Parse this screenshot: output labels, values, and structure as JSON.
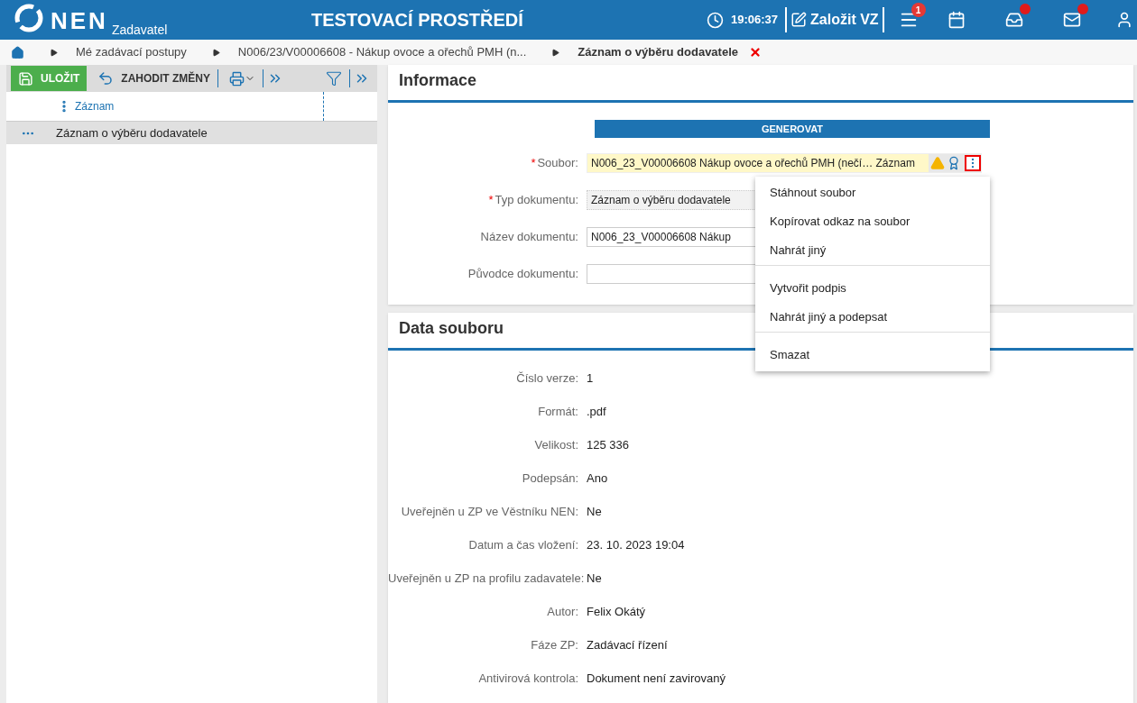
{
  "header": {
    "logo": "NEN",
    "subtitle": "Zadavatel",
    "environment": "TESTOVACÍ PROSTŘEDÍ",
    "time": "19:06:37",
    "create_button": "Založit VZ",
    "menu_badge": "1",
    "inbox_dot": true,
    "mail_dot": true
  },
  "breadcrumb": {
    "items": [
      "Mé zadávací postupy",
      "N006/23/V00006608 - Nákup ovoce a ořechů PMH (n...",
      "Záznam o výběru dodavatele"
    ]
  },
  "toolbar": {
    "save": "ULOŽIT",
    "discard": "ZAHODIT ZMĚNY"
  },
  "list": {
    "column": "Záznam",
    "rows": [
      {
        "label": "Záznam o výběru dodavatele",
        "selected": true
      }
    ]
  },
  "informace": {
    "title": "Informace",
    "generate": "GENEROVAT",
    "required_mark": "*",
    "fields": [
      {
        "label": "Soubor:",
        "required": true,
        "kind": "file",
        "value": "N006_23_V00006608 Nákup ovoce a ořechů PMH (nečí… Záznam"
      },
      {
        "label": "Typ dokumentu:",
        "required": true,
        "kind": "select",
        "value": "Záznam o výběru dodavatele"
      },
      {
        "label": "Název dokumentu:",
        "required": false,
        "kind": "text",
        "value": "N006_23_V00006608 Nákup"
      },
      {
        "label": "Původce dokumentu:",
        "required": false,
        "kind": "text"
      }
    ]
  },
  "menu": {
    "groups": [
      [
        "Stáhnout soubor",
        "Kopírovat odkaz na soubor",
        "Nahrát jiný"
      ],
      [
        "Vytvořit podpis",
        "Nahrát jiný a podepsat"
      ],
      [
        "Smazat"
      ]
    ]
  },
  "data_souboru": {
    "title": "Data souboru",
    "rows": [
      {
        "label": "Číslo verze:",
        "value": "1"
      },
      {
        "label": "Formát:",
        "value": ".pdf"
      },
      {
        "label": "Velikost:",
        "value": "125 336"
      },
      {
        "label": "Podepsán:",
        "value": "Ano"
      },
      {
        "label": "Uveřejněn u ZP ve Věstníku NEN:",
        "value": "Ne"
      },
      {
        "label": "Datum a čas vložení:",
        "value": "23. 10. 2023 19:04"
      },
      {
        "label": "Uveřejněn u ZP na profilu zadavatele:",
        "value": "Ne"
      },
      {
        "label": "Autor:",
        "value": "Felix Okátý"
      },
      {
        "label": "Fáze ZP:",
        "value": "Zadávací řízení"
      },
      {
        "label": "Antivirová kontrola:",
        "value": "Dokument není zavirovaný"
      }
    ]
  }
}
